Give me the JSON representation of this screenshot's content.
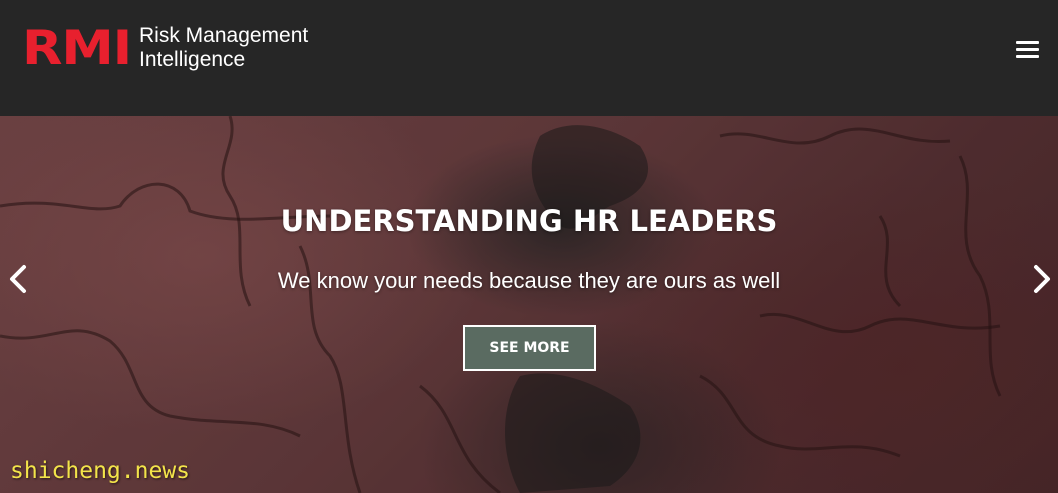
{
  "header": {
    "logo_mark": "RMI",
    "logo_line1": "Risk Management",
    "logo_line2": "Intelligence",
    "menu_icon": "hamburger-menu-icon"
  },
  "hero": {
    "title": "UNDERSTANDING HR LEADERS",
    "subtitle": "We know your needs because they are ours as well",
    "button_label": "SEE MORE",
    "prev_icon": "chevron-left-icon",
    "next_icon": "chevron-right-icon"
  },
  "watermark": {
    "text": "shicheng.news"
  },
  "colors": {
    "header_bg": "#262626",
    "brand_red": "#e8202e",
    "button_bg": "#5a6b61",
    "watermark": "#f3e44a"
  }
}
